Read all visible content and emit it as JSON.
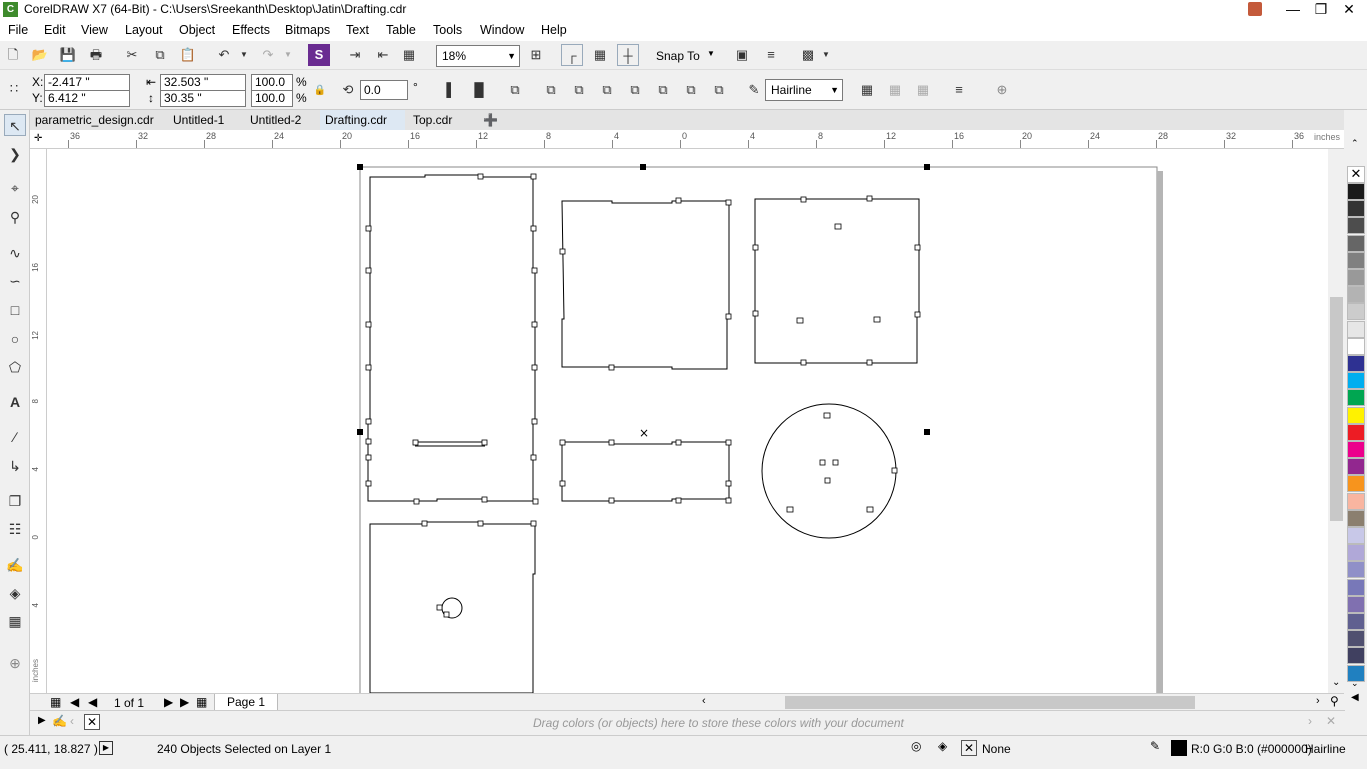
{
  "window": {
    "title": "CorelDRAW X7 (64-Bit) - C:\\Users\\Sreekanth\\Desktop\\Jatin\\Drafting.cdr",
    "app_icon_letter": "C"
  },
  "menu": [
    "File",
    "Edit",
    "View",
    "Layout",
    "Object",
    "Effects",
    "Bitmaps",
    "Text",
    "Table",
    "Tools",
    "Window",
    "Help"
  ],
  "standard_toolbar": {
    "zoom_value": "18%",
    "snap_to_label": "Snap To"
  },
  "property_bar": {
    "x_label": "X:",
    "x_value": "-2.417 \"",
    "y_label": "Y:",
    "y_value": "6.412 \"",
    "width_value": "32.503 \"",
    "height_value": "30.35 \"",
    "scale_w": "100.0",
    "scale_h": "100.0",
    "percent_symbol": "%",
    "rotation_value": "0.0",
    "degree_symbol": "°",
    "outline_width": "Hairline"
  },
  "doc_tabs": [
    {
      "label": "parametric_design.cdr",
      "active": false
    },
    {
      "label": "Untitled-1",
      "active": false
    },
    {
      "label": "Untitled-2",
      "active": false
    },
    {
      "label": "Drafting.cdr",
      "active": true
    },
    {
      "label": "Top.cdr",
      "active": false
    }
  ],
  "ruler": {
    "h_ticks": [
      "36",
      "32",
      "28",
      "24",
      "20",
      "16",
      "12",
      "8",
      "4",
      "0",
      "4",
      "8",
      "12",
      "16",
      "20",
      "24",
      "28",
      "32",
      "36"
    ],
    "units": "inches",
    "v_ticks": [
      "20",
      "16",
      "12",
      "8",
      "4",
      "0",
      "4"
    ],
    "v_units": "inches"
  },
  "page_nav": {
    "page_count": "1 of 1",
    "page_tab": "Page 1"
  },
  "doc_palette": {
    "hint": "Drag colors (or objects) here to store these colors with your document"
  },
  "status": {
    "coords": "( 25.411, 18.827 )",
    "selection": "240 Objects Selected on Layer 1",
    "fill": "None",
    "outline_color": "R:0 G:0 B:0 (#000000)",
    "outline_width": "Hairline"
  },
  "palette_colors": [
    "#1a1a1a",
    "#333333",
    "#4d4d4d",
    "#666666",
    "#808080",
    "#999999",
    "#b3b3b3",
    "#cccccc",
    "#e6e6e6",
    "#ffffff",
    "#2e3192",
    "#00aeef",
    "#00a651",
    "#fff200",
    "#ed1c24",
    "#ec008c",
    "#92278f",
    "#f7941d",
    "#f9b5a0",
    "#8b7f6f",
    "#c8c8e8",
    "#b0a8d8",
    "#9090c8",
    "#7878b8",
    "#8070b0",
    "#606090",
    "#505070",
    "#404060",
    "#2080c0"
  ],
  "colors": {
    "doc_tab_active": "#dde8f3",
    "canvas": "#ffffff",
    "chrome": "#f0f0f0"
  }
}
